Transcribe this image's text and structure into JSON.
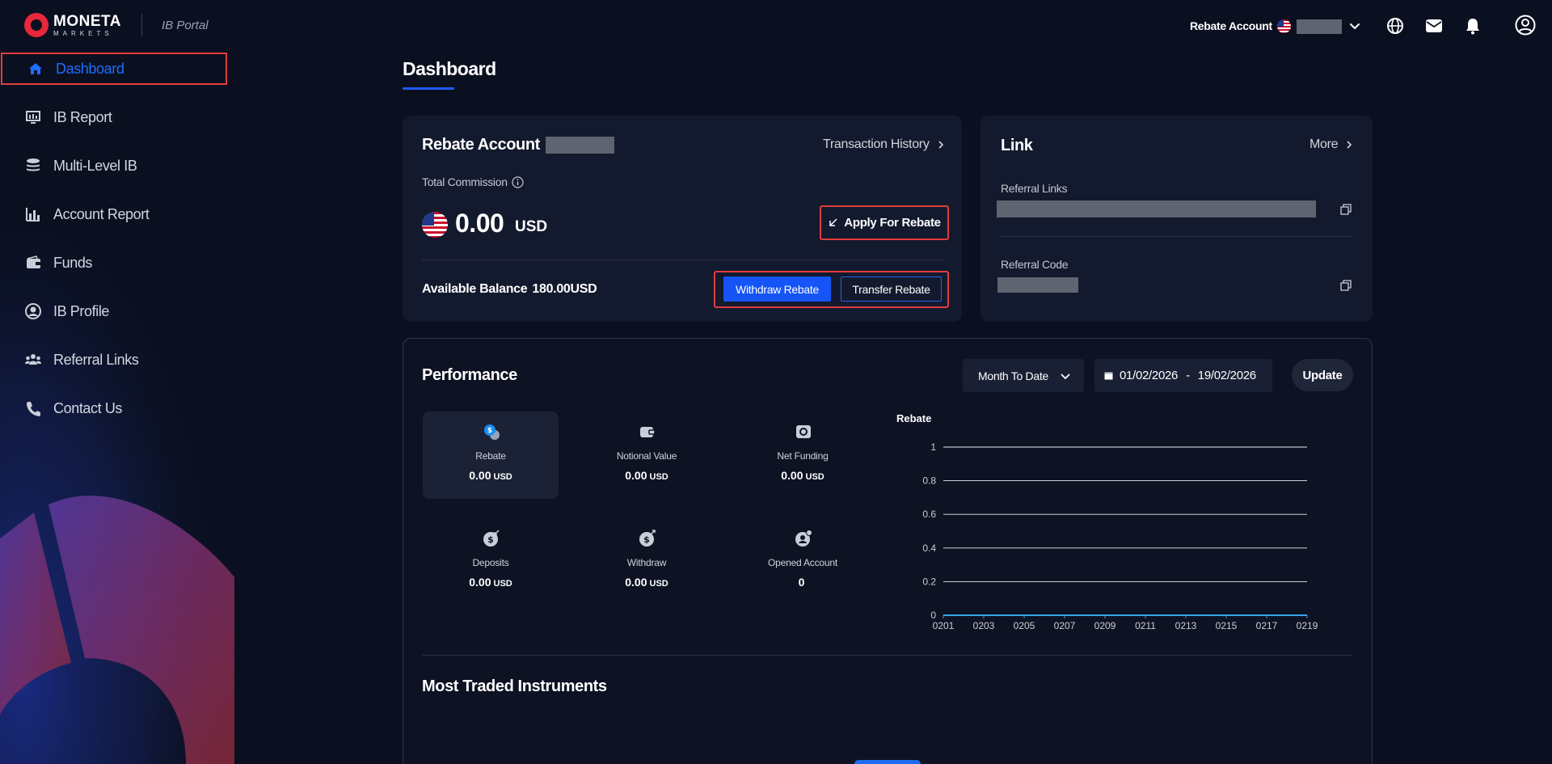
{
  "brand": {
    "name": "MONETA",
    "sub": "MARKETS",
    "portal": "IB Portal"
  },
  "header": {
    "account_label": "Rebate Account",
    "icons": [
      "globe-icon",
      "mail-icon",
      "bell-icon",
      "user-icon"
    ]
  },
  "sidebar": {
    "items": [
      {
        "label": "Dashboard",
        "icon": "home-icon",
        "active": true
      },
      {
        "label": "IB Report",
        "icon": "report-icon"
      },
      {
        "label": "Multi-Level IB",
        "icon": "layers-icon"
      },
      {
        "label": "Account Report",
        "icon": "bar-chart-icon"
      },
      {
        "label": "Funds",
        "icon": "wallet-icon"
      },
      {
        "label": "IB Profile",
        "icon": "profile-icon"
      },
      {
        "label": "Referral Links",
        "icon": "users-icon"
      },
      {
        "label": "Contact Us",
        "icon": "phone-icon"
      }
    ]
  },
  "page": {
    "title": "Dashboard"
  },
  "rebate_card": {
    "title": "Rebate Account",
    "transaction_history": "Transaction History",
    "total_commission_label": "Total Commission",
    "amount": "0.00",
    "currency": "USD",
    "apply_label": "Apply For Rebate",
    "available_label": "Available Balance",
    "available_value": "180.00USD",
    "withdraw_label": "Withdraw Rebate",
    "transfer_label": "Transfer Rebate"
  },
  "link_card": {
    "title": "Link",
    "more": "More",
    "referral_links_label": "Referral Links",
    "referral_code_label": "Referral Code"
  },
  "performance": {
    "title": "Performance",
    "period": "Month To Date",
    "date_from": "01/02/2026",
    "date_sep": "-",
    "date_to": "19/02/2026",
    "update_label": "Update",
    "metrics": [
      {
        "label": "Rebate",
        "value": "0.00",
        "unit": "USD",
        "icon": "rebate-coin-icon"
      },
      {
        "label": "Notional Value",
        "value": "0.00",
        "unit": "USD",
        "icon": "notional-wallet-icon"
      },
      {
        "label": "Net Funding",
        "value": "0.00",
        "unit": "USD",
        "icon": "net-funding-icon"
      },
      {
        "label": "Deposits",
        "value": "0.00",
        "unit": "USD",
        "icon": "deposit-icon"
      },
      {
        "label": "Withdraw",
        "value": "0.00",
        "unit": "USD",
        "icon": "withdraw-icon"
      },
      {
        "label": "Opened Account",
        "value": "0",
        "unit": "",
        "icon": "opened-account-icon"
      }
    ],
    "most_traded_title": "Most Traded Instruments"
  },
  "chart_data": {
    "type": "line",
    "title": "Rebate",
    "categories": [
      "0201",
      "0203",
      "0205",
      "0207",
      "0209",
      "0211",
      "0213",
      "0215",
      "0217",
      "0219"
    ],
    "series": [
      {
        "values": [
          0,
          0,
          0,
          0,
          0,
          0,
          0,
          0,
          0,
          0
        ]
      }
    ],
    "ylim": [
      0,
      1
    ],
    "yticks": [
      "0",
      "0.2",
      "0.4",
      "0.6",
      "0.8",
      "1"
    ],
    "grid": true,
    "line_color": "#35a5e6"
  }
}
